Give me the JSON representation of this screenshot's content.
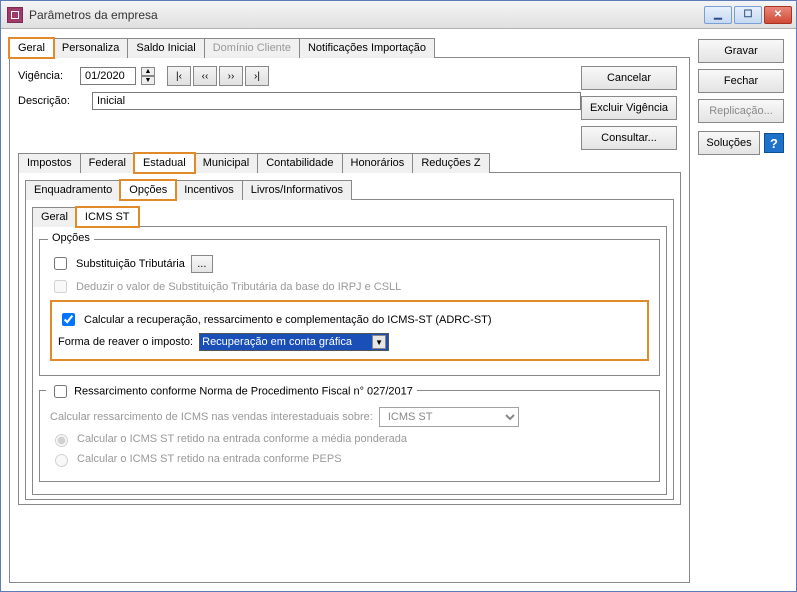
{
  "window": {
    "title": "Parâmetros da empresa"
  },
  "win_btns": {
    "min": "▁",
    "max": "☐",
    "close": "✕"
  },
  "top_tabs": [
    "Geral",
    "Personaliza",
    "Saldo Inicial",
    "Domínio Cliente",
    "Notificações Importação"
  ],
  "vigencia": {
    "label": "Vigência:",
    "value": "01/2020",
    "nav": {
      "first": "|‹",
      "prev": "‹‹",
      "next": "››",
      "last": "›|"
    }
  },
  "descricao": {
    "label": "Descrição:",
    "value": "Inicial"
  },
  "actions": {
    "cancelar": "Cancelar",
    "excluir": "Excluir Vigência",
    "consultar": "Consultar..."
  },
  "side": {
    "gravar": "Gravar",
    "fechar": "Fechar",
    "replicacao": "Replicação...",
    "solucoes": "Soluções"
  },
  "tabs2": [
    "Impostos",
    "Federal",
    "Estadual",
    "Municipal",
    "Contabilidade",
    "Honorários",
    "Reduções Z"
  ],
  "tabs3": [
    "Enquadramento",
    "Opções",
    "Incentivos",
    "Livros/Informativos"
  ],
  "tabs4": [
    "Geral",
    "ICMS ST"
  ],
  "opcoes": {
    "legend": "Opções",
    "sub_trib": "Substituição Tributária",
    "deduzir": "Deduzir o valor de Substituição Tributária da base do IRPJ e CSLL",
    "calcular_adrc": "Calcular a recuperação, ressarcimento e complementação do ICMS-ST (ADRC-ST)",
    "forma_label": "Forma de reaver o imposto:",
    "forma_value": "Recuperação em conta gráfica"
  },
  "ressarc": {
    "top": "Ressarcimento conforme Norma de Procedimento Fiscal n° 027/2017",
    "calc_label": "Calcular ressarcimento de ICMS nas vendas interestaduais sobre:",
    "select_value": "ICMS ST",
    "r1": "Calcular o ICMS ST retido na entrada conforme a média ponderada",
    "r2": "Calcular o ICMS ST retido na entrada conforme PEPS"
  },
  "icons": {
    "ellipsis": "...",
    "help": "?"
  }
}
